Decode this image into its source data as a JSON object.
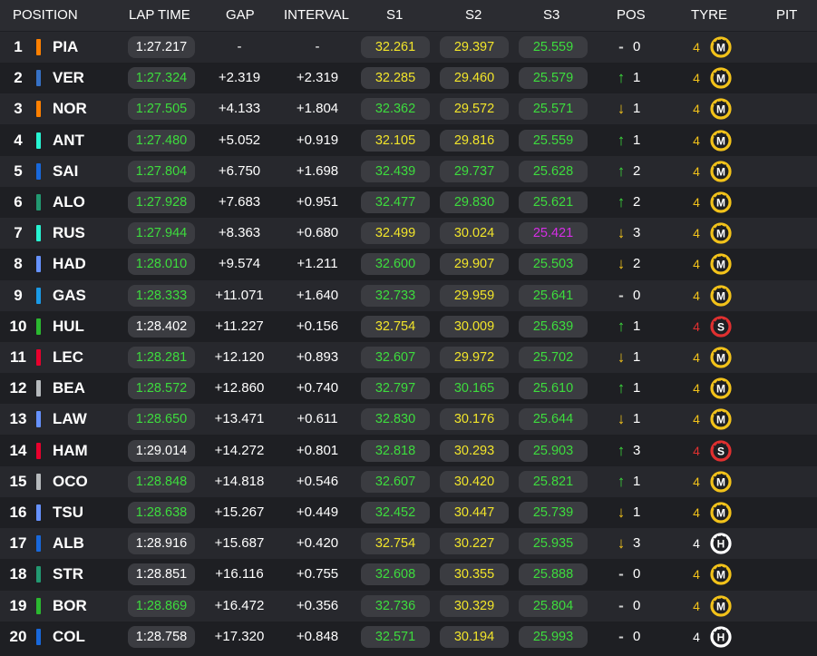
{
  "headers": {
    "position": "POSITION",
    "lap_time": "LAP TIME",
    "gap": "GAP",
    "interval": "INTERVAL",
    "s1": "S1",
    "s2": "S2",
    "s3": "S3",
    "pos": "POS",
    "tyre": "TYRE",
    "pit": "PIT"
  },
  "colors": {
    "white": "#ffffff",
    "green": "#3ddc3d",
    "yellow": "#f2e52a",
    "purple": "#d62ee6",
    "arrow_up": "#3ddc3d",
    "arrow_down": "#f2c21a",
    "neutral": "#cfcfcf",
    "medium_tyre": "#f2c21a",
    "soft_tyre": "#e03030",
    "hard_tyre": "#ffffff"
  },
  "rows": [
    {
      "pos": "1",
      "team_color": "#ff8000",
      "driver": "PIA",
      "lap": "1:27.217",
      "lap_c": "white",
      "gap": "-",
      "interval": "-",
      "s1": "32.261",
      "s1_c": "yellow",
      "s2": "29.397",
      "s2_c": "yellow",
      "s3": "25.559",
      "s3_c": "green",
      "arrow": "-",
      "arrow_c": "neutral",
      "chg": "0",
      "age": "4",
      "tyre": "M",
      "tyre_c": "medium_tyre"
    },
    {
      "pos": "2",
      "team_color": "#3671c6",
      "driver": "VER",
      "lap": "1:27.324",
      "lap_c": "green",
      "gap": "+2.319",
      "interval": "+2.319",
      "s1": "32.285",
      "s1_c": "yellow",
      "s2": "29.460",
      "s2_c": "yellow",
      "s3": "25.579",
      "s3_c": "green",
      "arrow": "↑",
      "arrow_c": "arrow_up",
      "chg": "1",
      "age": "4",
      "tyre": "M",
      "tyre_c": "medium_tyre"
    },
    {
      "pos": "3",
      "team_color": "#ff8000",
      "driver": "NOR",
      "lap": "1:27.505",
      "lap_c": "green",
      "gap": "+4.133",
      "interval": "+1.804",
      "s1": "32.362",
      "s1_c": "green",
      "s2": "29.572",
      "s2_c": "yellow",
      "s3": "25.571",
      "s3_c": "green",
      "arrow": "↓",
      "arrow_c": "arrow_down",
      "chg": "1",
      "age": "4",
      "tyre": "M",
      "tyre_c": "medium_tyre"
    },
    {
      "pos": "4",
      "team_color": "#27f4d2",
      "driver": "ANT",
      "lap": "1:27.480",
      "lap_c": "green",
      "gap": "+5.052",
      "interval": "+0.919",
      "s1": "32.105",
      "s1_c": "yellow",
      "s2": "29.816",
      "s2_c": "yellow",
      "s3": "25.559",
      "s3_c": "green",
      "arrow": "↑",
      "arrow_c": "arrow_up",
      "chg": "1",
      "age": "4",
      "tyre": "M",
      "tyre_c": "medium_tyre"
    },
    {
      "pos": "5",
      "team_color": "#1868db",
      "driver": "SAI",
      "lap": "1:27.804",
      "lap_c": "green",
      "gap": "+6.750",
      "interval": "+1.698",
      "s1": "32.439",
      "s1_c": "green",
      "s2": "29.737",
      "s2_c": "green",
      "s3": "25.628",
      "s3_c": "green",
      "arrow": "↑",
      "arrow_c": "arrow_up",
      "chg": "2",
      "age": "4",
      "tyre": "M",
      "tyre_c": "medium_tyre"
    },
    {
      "pos": "6",
      "team_color": "#229971",
      "driver": "ALO",
      "lap": "1:27.928",
      "lap_c": "green",
      "gap": "+7.683",
      "interval": "+0.951",
      "s1": "32.477",
      "s1_c": "green",
      "s2": "29.830",
      "s2_c": "green",
      "s3": "25.621",
      "s3_c": "green",
      "arrow": "↑",
      "arrow_c": "arrow_up",
      "chg": "2",
      "age": "4",
      "tyre": "M",
      "tyre_c": "medium_tyre"
    },
    {
      "pos": "7",
      "team_color": "#27f4d2",
      "driver": "RUS",
      "lap": "1:27.944",
      "lap_c": "green",
      "gap": "+8.363",
      "interval": "+0.680",
      "s1": "32.499",
      "s1_c": "yellow",
      "s2": "30.024",
      "s2_c": "yellow",
      "s3": "25.421",
      "s3_c": "purple",
      "arrow": "↓",
      "arrow_c": "arrow_down",
      "chg": "3",
      "age": "4",
      "tyre": "M",
      "tyre_c": "medium_tyre"
    },
    {
      "pos": "8",
      "team_color": "#6692ff",
      "driver": "HAD",
      "lap": "1:28.010",
      "lap_c": "green",
      "gap": "+9.574",
      "interval": "+1.211",
      "s1": "32.600",
      "s1_c": "green",
      "s2": "29.907",
      "s2_c": "yellow",
      "s3": "25.503",
      "s3_c": "green",
      "arrow": "↓",
      "arrow_c": "arrow_down",
      "chg": "2",
      "age": "4",
      "tyre": "M",
      "tyre_c": "medium_tyre"
    },
    {
      "pos": "9",
      "team_color": "#1a9ae6",
      "driver": "GAS",
      "lap": "1:28.333",
      "lap_c": "green",
      "gap": "+11.071",
      "interval": "+1.640",
      "s1": "32.733",
      "s1_c": "green",
      "s2": "29.959",
      "s2_c": "yellow",
      "s3": "25.641",
      "s3_c": "green",
      "arrow": "-",
      "arrow_c": "neutral",
      "chg": "0",
      "age": "4",
      "tyre": "M",
      "tyre_c": "medium_tyre"
    },
    {
      "pos": "10",
      "team_color": "#2bb830",
      "driver": "HUL",
      "lap": "1:28.402",
      "lap_c": "white",
      "gap": "+11.227",
      "interval": "+0.156",
      "s1": "32.754",
      "s1_c": "yellow",
      "s2": "30.009",
      "s2_c": "yellow",
      "s3": "25.639",
      "s3_c": "green",
      "arrow": "↑",
      "arrow_c": "arrow_up",
      "chg": "1",
      "age": "4",
      "tyre": "S",
      "tyre_c": "soft_tyre"
    },
    {
      "pos": "11",
      "team_color": "#e8002d",
      "driver": "LEC",
      "lap": "1:28.281",
      "lap_c": "green",
      "gap": "+12.120",
      "interval": "+0.893",
      "s1": "32.607",
      "s1_c": "green",
      "s2": "29.972",
      "s2_c": "yellow",
      "s3": "25.702",
      "s3_c": "green",
      "arrow": "↓",
      "arrow_c": "arrow_down",
      "chg": "1",
      "age": "4",
      "tyre": "M",
      "tyre_c": "medium_tyre"
    },
    {
      "pos": "12",
      "team_color": "#b6babd",
      "driver": "BEA",
      "lap": "1:28.572",
      "lap_c": "green",
      "gap": "+12.860",
      "interval": "+0.740",
      "s1": "32.797",
      "s1_c": "green",
      "s2": "30.165",
      "s2_c": "green",
      "s3": "25.610",
      "s3_c": "green",
      "arrow": "↑",
      "arrow_c": "arrow_up",
      "chg": "1",
      "age": "4",
      "tyre": "M",
      "tyre_c": "medium_tyre"
    },
    {
      "pos": "13",
      "team_color": "#6692ff",
      "driver": "LAW",
      "lap": "1:28.650",
      "lap_c": "green",
      "gap": "+13.471",
      "interval": "+0.611",
      "s1": "32.830",
      "s1_c": "green",
      "s2": "30.176",
      "s2_c": "yellow",
      "s3": "25.644",
      "s3_c": "green",
      "arrow": "↓",
      "arrow_c": "arrow_down",
      "chg": "1",
      "age": "4",
      "tyre": "M",
      "tyre_c": "medium_tyre"
    },
    {
      "pos": "14",
      "team_color": "#e8002d",
      "driver": "HAM",
      "lap": "1:29.014",
      "lap_c": "white",
      "gap": "+14.272",
      "interval": "+0.801",
      "s1": "32.818",
      "s1_c": "green",
      "s2": "30.293",
      "s2_c": "yellow",
      "s3": "25.903",
      "s3_c": "green",
      "arrow": "↑",
      "arrow_c": "arrow_up",
      "chg": "3",
      "age": "4",
      "tyre": "S",
      "tyre_c": "soft_tyre"
    },
    {
      "pos": "15",
      "team_color": "#b6babd",
      "driver": "OCO",
      "lap": "1:28.848",
      "lap_c": "green",
      "gap": "+14.818",
      "interval": "+0.546",
      "s1": "32.607",
      "s1_c": "green",
      "s2": "30.420",
      "s2_c": "yellow",
      "s3": "25.821",
      "s3_c": "green",
      "arrow": "↑",
      "arrow_c": "arrow_up",
      "chg": "1",
      "age": "4",
      "tyre": "M",
      "tyre_c": "medium_tyre"
    },
    {
      "pos": "16",
      "team_color": "#6692ff",
      "driver": "TSU",
      "lap": "1:28.638",
      "lap_c": "green",
      "gap": "+15.267",
      "interval": "+0.449",
      "s1": "32.452",
      "s1_c": "green",
      "s2": "30.447",
      "s2_c": "yellow",
      "s3": "25.739",
      "s3_c": "green",
      "arrow": "↓",
      "arrow_c": "arrow_down",
      "chg": "1",
      "age": "4",
      "tyre": "M",
      "tyre_c": "medium_tyre"
    },
    {
      "pos": "17",
      "team_color": "#1868db",
      "driver": "ALB",
      "lap": "1:28.916",
      "lap_c": "white",
      "gap": "+15.687",
      "interval": "+0.420",
      "s1": "32.754",
      "s1_c": "yellow",
      "s2": "30.227",
      "s2_c": "yellow",
      "s3": "25.935",
      "s3_c": "green",
      "arrow": "↓",
      "arrow_c": "arrow_down",
      "chg": "3",
      "age": "4",
      "tyre": "H",
      "tyre_c": "hard_tyre"
    },
    {
      "pos": "18",
      "team_color": "#229971",
      "driver": "STR",
      "lap": "1:28.851",
      "lap_c": "white",
      "gap": "+16.116",
      "interval": "+0.755",
      "s1": "32.608",
      "s1_c": "green",
      "s2": "30.355",
      "s2_c": "yellow",
      "s3": "25.888",
      "s3_c": "green",
      "arrow": "-",
      "arrow_c": "neutral",
      "chg": "0",
      "age": "4",
      "tyre": "M",
      "tyre_c": "medium_tyre"
    },
    {
      "pos": "19",
      "team_color": "#2bb830",
      "driver": "BOR",
      "lap": "1:28.869",
      "lap_c": "green",
      "gap": "+16.472",
      "interval": "+0.356",
      "s1": "32.736",
      "s1_c": "green",
      "s2": "30.329",
      "s2_c": "yellow",
      "s3": "25.804",
      "s3_c": "green",
      "arrow": "-",
      "arrow_c": "neutral",
      "chg": "0",
      "age": "4",
      "tyre": "M",
      "tyre_c": "medium_tyre"
    },
    {
      "pos": "20",
      "team_color": "#1868db",
      "driver": "COL",
      "lap": "1:28.758",
      "lap_c": "white",
      "gap": "+17.320",
      "interval": "+0.848",
      "s1": "32.571",
      "s1_c": "green",
      "s2": "30.194",
      "s2_c": "yellow",
      "s3": "25.993",
      "s3_c": "green",
      "arrow": "-",
      "arrow_c": "neutral",
      "chg": "0",
      "age": "4",
      "tyre": "H",
      "tyre_c": "hard_tyre"
    }
  ]
}
